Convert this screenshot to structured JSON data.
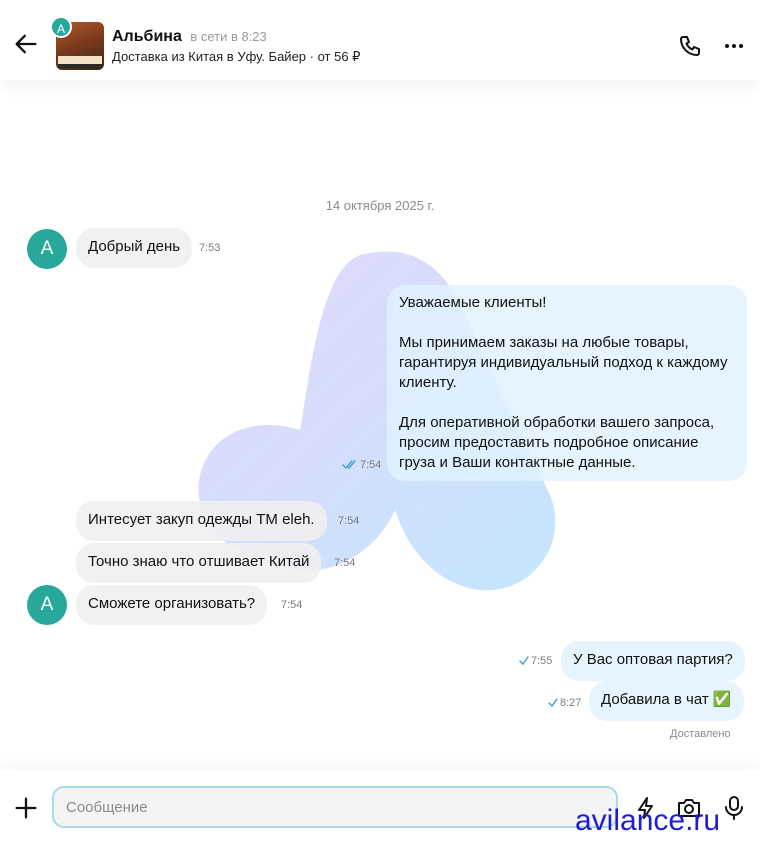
{
  "header": {
    "avatar_letter": "A",
    "contact_name": "Альбина",
    "status": "в сети в 8:23",
    "subtitle": "Доставка из Китая в Уфу. Байер · от 56 ₽"
  },
  "chat": {
    "date_separator": "14 октября 2025 г.",
    "avatar_letter": "A",
    "messages": [
      {
        "direction": "in",
        "text": "Добрый день",
        "time": "7:53"
      },
      {
        "direction": "out",
        "text": "Уважаемые клиенты!\n\nМы принимаем заказы на любые товары, гарантируя индивидуальный подход к каждому клиенту.\n\nДля оперативной обработки вашего запроса, просим предоставить подробное описание груза и Ваши контактные данные.",
        "time": "7:54"
      },
      {
        "direction": "in",
        "text": "Интесует закуп одежды ТМ eleh.",
        "time": "7:54"
      },
      {
        "direction": "in",
        "text": "Точно знаю что отшивает Китай",
        "time": "7:54"
      },
      {
        "direction": "in",
        "text": "Сможете организовать?",
        "time": "7:54"
      },
      {
        "direction": "out",
        "text": "У Вас оптовая партия?",
        "time": "7:55"
      },
      {
        "direction": "out",
        "text": "Добавила в чат ✅",
        "time": "8:27"
      }
    ],
    "delivery_status": "Доставлено"
  },
  "composer": {
    "placeholder": "Сообщение",
    "value": ""
  },
  "watermark": {
    "text": "avilance.ru"
  },
  "colors": {
    "accent_teal": "#27a89a",
    "outgoing_bubble": "#e1f2ff",
    "incoming_bubble": "#f0f0f0",
    "tick_blue": "#3aa0d8"
  },
  "icons": [
    "back-arrow-icon",
    "phone-icon",
    "more-dots-icon",
    "plus-icon",
    "bolt-icon",
    "camera-icon",
    "mic-icon",
    "double-check-icon"
  ]
}
